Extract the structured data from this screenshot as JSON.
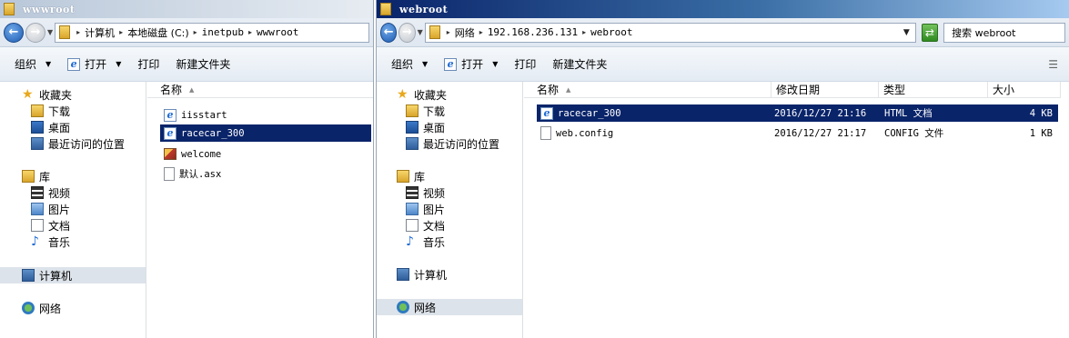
{
  "left": {
    "title": "wwwroot",
    "address": {
      "crumbs": [
        "计算机",
        "本地磁盘 (C:)",
        "inetpub",
        "wwwroot"
      ]
    },
    "toolbar": {
      "organize": "组织",
      "open": "打开",
      "print": "打印",
      "new_folder": "新建文件夹"
    },
    "nav": {
      "favorites": "收藏夹",
      "downloads": "下载",
      "desktop": "桌面",
      "recent": "最近访问的位置",
      "libraries": "库",
      "videos": "视频",
      "pictures": "图片",
      "documents": "文档",
      "music": "音乐",
      "computer": "计算机",
      "network": "网络"
    },
    "columns": {
      "name": "名称"
    },
    "files": [
      {
        "name": "iisstart",
        "icon": "ie-file-icon"
      },
      {
        "name": "racecar_300",
        "icon": "ie-file-icon"
      },
      {
        "name": "welcome",
        "icon": "image-file-icon"
      },
      {
        "name": "默认.asx",
        "icon": "blank-file-icon"
      }
    ]
  },
  "right": {
    "title": "webroot",
    "address": {
      "crumbs": [
        "网络",
        "192.168.236.131",
        "webroot"
      ]
    },
    "search": {
      "placeholder": "搜索 webroot"
    },
    "toolbar": {
      "organize": "组织",
      "open": "打开",
      "print": "打印",
      "new_folder": "新建文件夹"
    },
    "nav": {
      "favorites": "收藏夹",
      "downloads": "下载",
      "desktop": "桌面",
      "recent": "最近访问的位置",
      "libraries": "库",
      "videos": "视频",
      "pictures": "图片",
      "documents": "文档",
      "music": "音乐",
      "computer": "计算机",
      "network": "网络"
    },
    "columns": {
      "name": "名称",
      "modified": "修改日期",
      "type": "类型",
      "size": "大小"
    },
    "files": [
      {
        "name": "racecar_300",
        "modified": "2016/12/27 21:16",
        "type": "HTML 文档",
        "size": "4 KB",
        "icon": "ie-file-icon"
      },
      {
        "name": "web.config",
        "modified": "2016/12/27 21:17",
        "type": "CONFIG 文件",
        "size": "1 KB",
        "icon": "blank-file-icon"
      }
    ]
  }
}
